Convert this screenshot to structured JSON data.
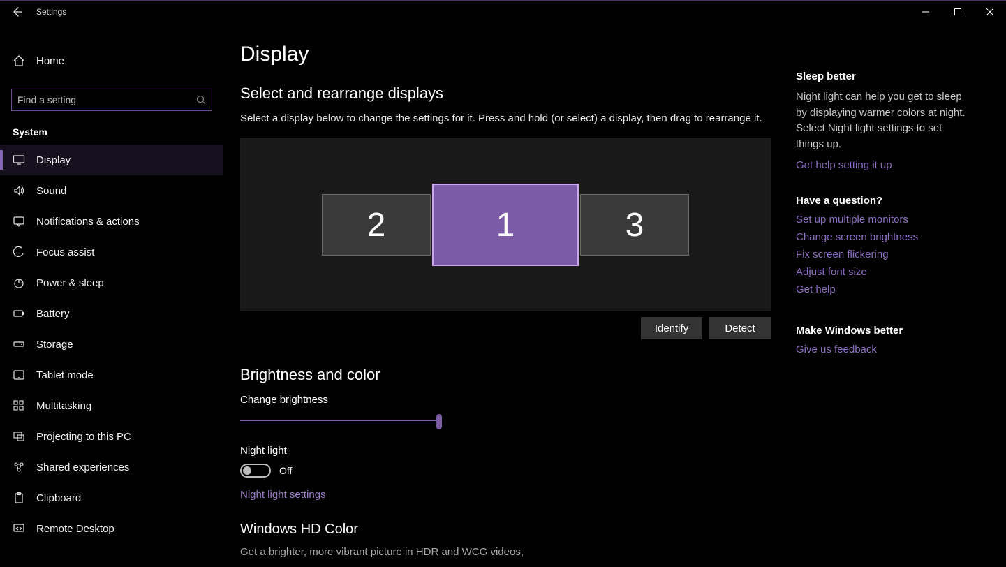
{
  "window": {
    "title": "Settings"
  },
  "home_label": "Home",
  "search": {
    "placeholder": "Find a setting"
  },
  "section_label": "System",
  "nav_items": [
    {
      "label": "Display"
    },
    {
      "label": "Sound"
    },
    {
      "label": "Notifications & actions"
    },
    {
      "label": "Focus assist"
    },
    {
      "label": "Power & sleep"
    },
    {
      "label": "Battery"
    },
    {
      "label": "Storage"
    },
    {
      "label": "Tablet mode"
    },
    {
      "label": "Multitasking"
    },
    {
      "label": "Projecting to this PC"
    },
    {
      "label": "Shared experiences"
    },
    {
      "label": "Clipboard"
    },
    {
      "label": "Remote Desktop"
    }
  ],
  "main": {
    "page_title": "Display",
    "rearrange_heading": "Select and rearrange displays",
    "rearrange_help": "Select a display below to change the settings for it. Press and hold (or select) a display, then drag to rearrange it.",
    "monitor_2": "2",
    "monitor_1": "1",
    "monitor_3": "3",
    "identify_btn": "Identify",
    "detect_btn": "Detect",
    "brightness_heading": "Brightness and color",
    "brightness_label": "Change brightness",
    "brightness_value": 100,
    "night_light_label": "Night light",
    "night_light_state": "Off",
    "night_light_link": "Night light settings",
    "hd_heading": "Windows HD Color",
    "hd_text": "Get a brighter, more vibrant picture in HDR and WCG videos,"
  },
  "right": {
    "sleep_heading": "Sleep better",
    "sleep_text": "Night light can help you get to sleep by displaying warmer colors at night. Select Night light settings to set things up.",
    "sleep_link": "Get help setting it up",
    "question_heading": "Have a question?",
    "question_links": [
      "Set up multiple monitors",
      "Change screen brightness",
      "Fix screen flickering",
      "Adjust font size",
      "Get help"
    ],
    "feedback_heading": "Make Windows better",
    "feedback_link": "Give us feedback"
  }
}
